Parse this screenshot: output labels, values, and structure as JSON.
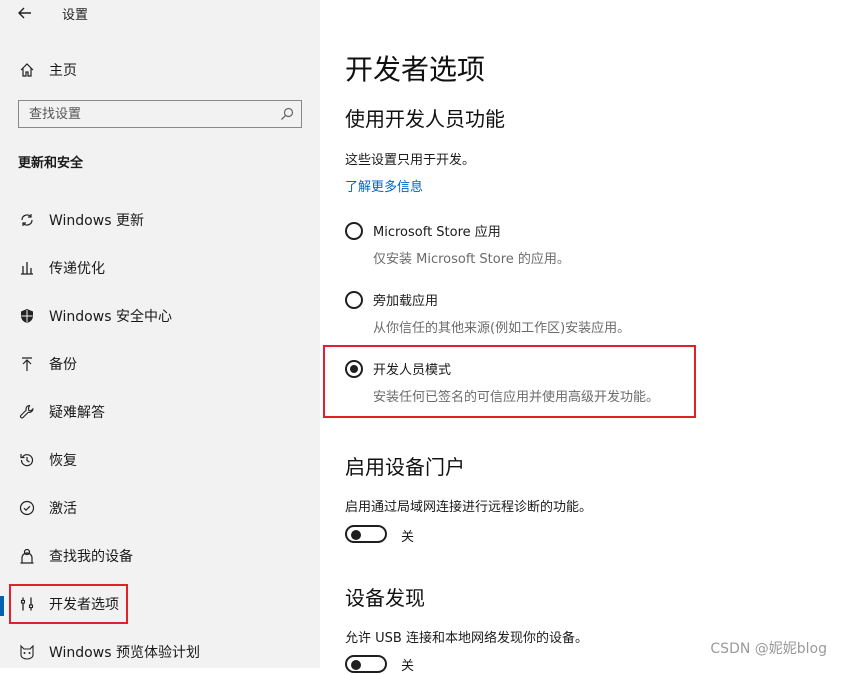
{
  "window": {
    "title": "设置"
  },
  "sidebar": {
    "home": {
      "label": "主页",
      "icon": "home-icon"
    },
    "search": {
      "placeholder": "查找设置"
    },
    "section_title": "更新和安全",
    "items": [
      {
        "label": "Windows 更新",
        "icon": "sync-icon"
      },
      {
        "label": "传递优化",
        "icon": "delivery-optimization-icon"
      },
      {
        "label": "Windows 安全中心",
        "icon": "shield-icon"
      },
      {
        "label": "备份",
        "icon": "backup-arrow-icon"
      },
      {
        "label": "疑难解答",
        "icon": "wrench-icon"
      },
      {
        "label": "恢复",
        "icon": "recovery-icon"
      },
      {
        "label": "激活",
        "icon": "check-circle-icon"
      },
      {
        "label": "查找我的设备",
        "icon": "person-location-icon"
      },
      {
        "label": "开发者选项",
        "icon": "developer-tools-icon",
        "selected": true
      },
      {
        "label": "Windows 预览体验计划",
        "icon": "cat-icon"
      }
    ]
  },
  "main": {
    "title": "开发者选项",
    "dev_section": {
      "heading": "使用开发人员功能",
      "description": "这些设置只用于开发。",
      "learn_more": "了解更多信息",
      "options": [
        {
          "label": "Microsoft Store 应用",
          "description": "仅安装 Microsoft Store 的应用。",
          "selected": false
        },
        {
          "label": "旁加载应用",
          "description": "从你信任的其他来源(例如工作区)安装应用。",
          "selected": false
        },
        {
          "label": "开发人员模式",
          "description": "安装任何已签名的可信应用并使用高级开发功能。",
          "selected": true
        }
      ]
    },
    "portal_section": {
      "heading": "启用设备门户",
      "description": "启用通过局域网连接进行远程诊断的功能。",
      "toggle_state": "关"
    },
    "discovery_section": {
      "heading": "设备发现",
      "description": "允许 USB 连接和本地网络发现你的设备。",
      "toggle_state": "关"
    }
  },
  "watermark": "CSDN @妮妮blog",
  "colors": {
    "accent": "#0063b1",
    "link": "#0066cc",
    "highlight": "#e0202a",
    "sidebar_bg": "#f2f2f2"
  }
}
